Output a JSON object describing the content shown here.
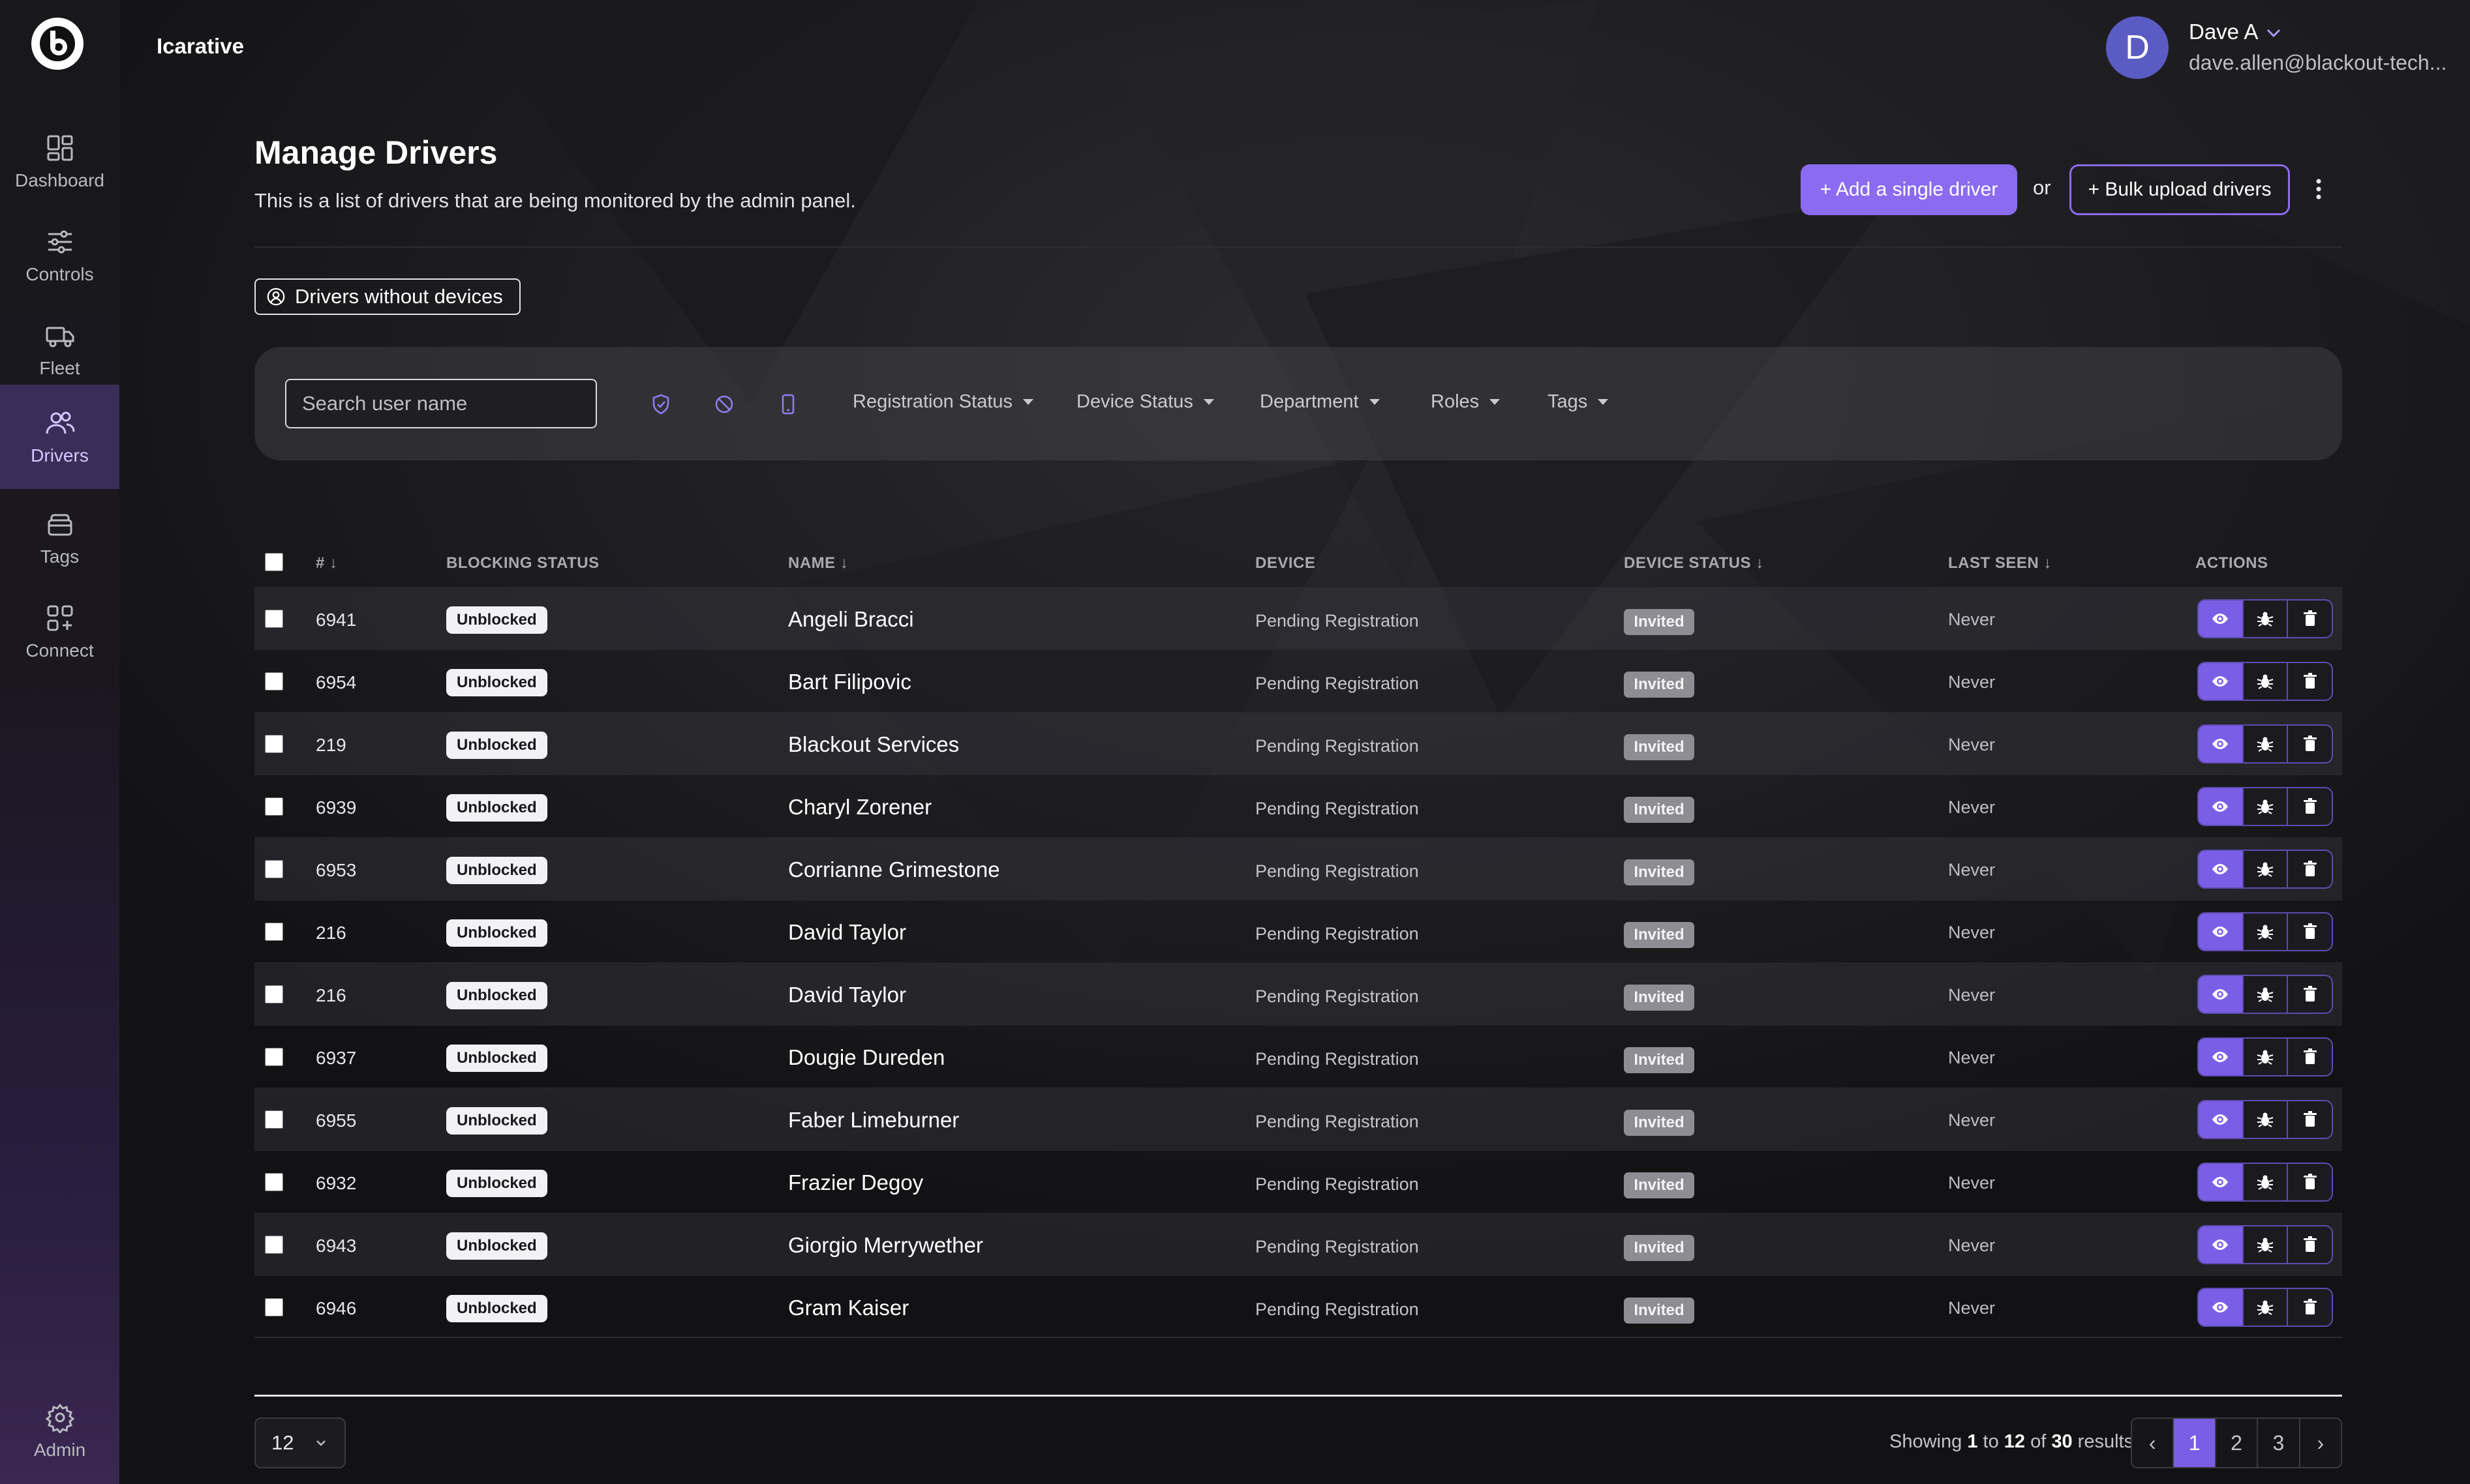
{
  "app": {
    "brand": "Icarative"
  },
  "user": {
    "initial": "D",
    "name": "Dave A",
    "email": "dave.allen@blackout-tech..."
  },
  "sidebar": {
    "items": [
      {
        "label": "Dashboard",
        "icon": "dashboard-icon"
      },
      {
        "label": "Controls",
        "icon": "sliders-icon"
      },
      {
        "label": "Fleet",
        "icon": "truck-icon"
      },
      {
        "label": "Drivers",
        "icon": "users-icon",
        "active": true
      },
      {
        "label": "Tags",
        "icon": "tag-icon"
      },
      {
        "label": "Connect",
        "icon": "apps-plus-icon"
      }
    ],
    "footer_label": "Admin"
  },
  "header": {
    "title": "Manage Drivers",
    "subtitle": "This is a list of drivers that are being monitored by the admin panel.",
    "add_label": "+ Add a single driver",
    "or_label": "or",
    "bulk_label": "+ Bulk upload drivers",
    "no_devices_label": "Drivers without devices"
  },
  "filters": {
    "search_placeholder": "Search user name",
    "dropdowns": [
      "Registration Status",
      "Device Status",
      "Department",
      "Roles",
      "Tags"
    ]
  },
  "table": {
    "headers": {
      "id": "# ↓",
      "blocking": "BLOCKING STATUS",
      "name": "NAME ↓",
      "device": "DEVICE",
      "device_status": "DEVICE STATUS ↓",
      "last_seen": "LAST SEEN ↓",
      "actions": "ACTIONS"
    },
    "rows": [
      {
        "id": "6941",
        "blocking": "Unblocked",
        "name": "Angeli Bracci",
        "device": "Pending Registration",
        "status": "Invited",
        "seen": "Never"
      },
      {
        "id": "6954",
        "blocking": "Unblocked",
        "name": "Bart Filipovic",
        "device": "Pending Registration",
        "status": "Invited",
        "seen": "Never"
      },
      {
        "id": "219",
        "blocking": "Unblocked",
        "name": "Blackout Services",
        "device": "Pending Registration",
        "status": "Invited",
        "seen": "Never"
      },
      {
        "id": "6939",
        "blocking": "Unblocked",
        "name": "Charyl Zorener",
        "device": "Pending Registration",
        "status": "Invited",
        "seen": "Never"
      },
      {
        "id": "6953",
        "blocking": "Unblocked",
        "name": "Corrianne Grimestone",
        "device": "Pending Registration",
        "status": "Invited",
        "seen": "Never"
      },
      {
        "id": "216",
        "blocking": "Unblocked",
        "name": "David Taylor",
        "device": "Pending Registration",
        "status": "Invited",
        "seen": "Never"
      },
      {
        "id": "216",
        "blocking": "Unblocked",
        "name": "David Taylor",
        "device": "Pending Registration",
        "status": "Invited",
        "seen": "Never"
      },
      {
        "id": "6937",
        "blocking": "Unblocked",
        "name": "Dougie Dureden",
        "device": "Pending Registration",
        "status": "Invited",
        "seen": "Never"
      },
      {
        "id": "6955",
        "blocking": "Unblocked",
        "name": "Faber Limeburner",
        "device": "Pending Registration",
        "status": "Invited",
        "seen": "Never"
      },
      {
        "id": "6932",
        "blocking": "Unblocked",
        "name": "Frazier Degoy",
        "device": "Pending Registration",
        "status": "Invited",
        "seen": "Never"
      },
      {
        "id": "6943",
        "blocking": "Unblocked",
        "name": "Giorgio Merrywether",
        "device": "Pending Registration",
        "status": "Invited",
        "seen": "Never"
      },
      {
        "id": "6946",
        "blocking": "Unblocked",
        "name": "Gram Kaiser",
        "device": "Pending Registration",
        "status": "Invited",
        "seen": "Never"
      }
    ]
  },
  "footer": {
    "per_page": "12",
    "showing_prefix": "Showing",
    "from": "1",
    "to_word": "to",
    "to": "12",
    "of_word": "of",
    "total": "30",
    "suffix": "results",
    "pages": [
      "1",
      "2",
      "3"
    ],
    "prev": "‹",
    "next": "›"
  },
  "colors": {
    "accent": "#8b6bf0",
    "active_nav": "#3b2d58",
    "background": "#121214"
  }
}
